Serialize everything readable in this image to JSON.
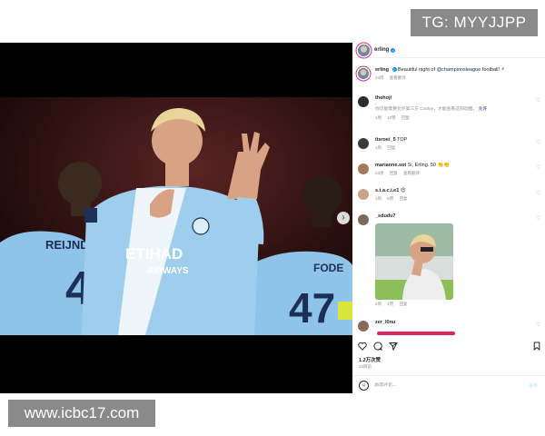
{
  "watermarks": {
    "top": "TG: MYYJJPP",
    "bottom": "www.icbc17.com"
  },
  "post": {
    "username": "erling",
    "caption_prefix": "Beautiful night of ",
    "caption_hashtag": "@championsleague",
    "caption_suffix": " football! ⚡",
    "caption_meta": [
      "23周",
      "查看翻译"
    ],
    "photo_text": {
      "sponsor": "ETIHAD",
      "sponsor_sub": "AIRWAYS",
      "player_left": "REIJNDE",
      "player_left_number": "4",
      "player_right": "FODE",
      "player_right_number": "47"
    },
    "carousel": {
      "count": 4,
      "active": 0
    }
  },
  "comments": [
    {
      "user": "thehoji",
      "text": "",
      "placeholder_icon": "broken-image-icon",
      "cn_line": "你可能需要允许第三方 Cookie，才能查看这则动图。",
      "cn_link": "允许",
      "meta": [
        "1周",
        "10赞",
        "回复"
      ]
    },
    {
      "user": "itsroei_5",
      "text": "TOP",
      "meta": [
        "1周",
        "回复"
      ]
    },
    {
      "user": "marianne.sot",
      "text": "Si, Erling. 50 👏👏",
      "meta": [
        "23周",
        "回复",
        "查看翻译"
      ]
    },
    {
      "user": "s.t.a.c.i.e1",
      "text": "😍",
      "meta": [
        "1周",
        "6赞",
        "回复"
      ]
    },
    {
      "user": "_sdudu7",
      "text": "",
      "meta": [
        "2周",
        "1赞",
        "回复"
      ]
    },
    {
      "user": "zer_l0nu",
      "text": "",
      "meta": []
    }
  ],
  "engagement": {
    "likes": "1.2万次赞",
    "date": "23周前"
  },
  "composer": {
    "placeholder": "添加评论...",
    "post_label": "发布"
  },
  "colors": {
    "accent": "#0095f6",
    "muted": "#8e8e8e",
    "jersey": "#8fc4ea"
  }
}
